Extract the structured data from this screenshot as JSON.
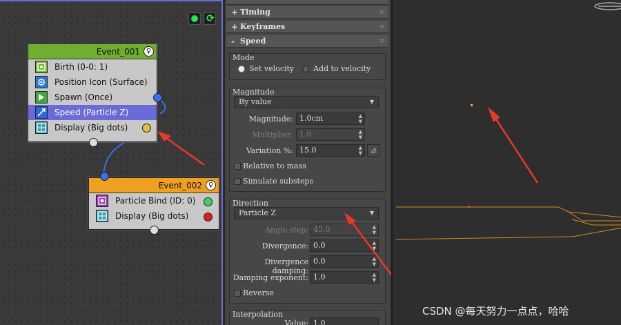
{
  "events": {
    "event1": {
      "title": "Event_001",
      "operators": [
        {
          "label": "Birth (0-0: 1)",
          "icon": "birth-icon"
        },
        {
          "label": "Position Icon (Surface)",
          "icon": "position-icon"
        },
        {
          "label": "Spawn (Once)",
          "icon": "spawn-icon"
        },
        {
          "label": "Speed (Particle Z)",
          "icon": "speed-icon",
          "selected": true
        },
        {
          "label": "Display (Big dots)",
          "icon": "display-icon"
        }
      ],
      "header_color": "#6fae2e"
    },
    "event2": {
      "title": "Event_002",
      "operators": [
        {
          "label": "Particle Bind (ID: 0)",
          "icon": "particle-bind-icon"
        },
        {
          "label": "Display (Big dots)",
          "icon": "display-icon"
        }
      ],
      "header_color": "#f0a020"
    }
  },
  "panel": {
    "rollouts": {
      "timing": "Timing",
      "keyframes": "Keyframes",
      "speed": "Speed"
    },
    "mode": {
      "title": "Mode",
      "set_velocity": "Set velocity",
      "add_to_velocity": "Add to velocity"
    },
    "magnitude": {
      "title": "Magnitude",
      "dropdown": "By value",
      "magnitude_label": "Magnitude:",
      "magnitude_value": "1.0cm",
      "multiplier_label": "Multiplier:",
      "multiplier_value": "1.0",
      "variation_label": "Variation %:",
      "variation_value": "15.0",
      "relative_to_mass": "Relative to mass",
      "simulate_substeps": "Simulate substeps"
    },
    "direction": {
      "title": "Direction",
      "dropdown": "Particle Z",
      "angle_step_label": "Angle step:",
      "angle_step_value": "45.0",
      "divergence_label": "Divergence:",
      "divergence_value": "0.0",
      "divergence_damping_label": "Divergence damping:",
      "divergence_damping_value": "0.0",
      "damping_exponent_label": "Damping exponent:",
      "damping_exponent_value": "1.0",
      "reverse": "Reverse"
    },
    "interpolation": {
      "title": "Interpolation",
      "value_label": "Value:",
      "value_value": "1.0"
    }
  },
  "watermark": "CSDN @每天努力一点点，哈哈",
  "colors": {
    "selection": "#6a6ad8",
    "annotation_arrow": "#e8392e",
    "viewport_lines": "#d98a1a"
  }
}
